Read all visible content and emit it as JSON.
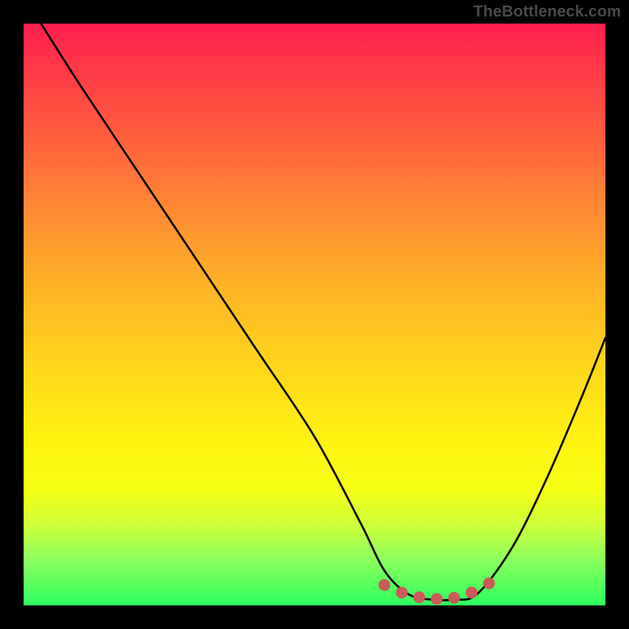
{
  "watermark": "TheBottleneck.com",
  "colors": {
    "background": "#000000",
    "gradient_top": "#ff1f4f",
    "gradient_bottom": "#2cff5e",
    "curve": "#000000",
    "marker_fill": "#cc5a57",
    "marker_stroke": "#cc5a57"
  },
  "chart_data": {
    "type": "line",
    "title": "",
    "xlabel": "",
    "ylabel": "",
    "xlim": [
      0,
      100
    ],
    "ylim": [
      0,
      100
    ],
    "grid": false,
    "series": [
      {
        "name": "bottleneck-curve",
        "x": [
          3,
          10,
          20,
          30,
          40,
          50,
          58,
          62,
          66,
          70,
          74,
          78,
          84,
          90,
          96,
          100
        ],
        "values": [
          100,
          89,
          74,
          59,
          44,
          29,
          14,
          6,
          2,
          1,
          1,
          2,
          10,
          22,
          36,
          46
        ]
      }
    ],
    "annotations": [
      {
        "name": "trough-markers",
        "kind": "scatter",
        "x": [
          62,
          65,
          68,
          71,
          74,
          77,
          80
        ],
        "values": [
          3.5,
          2.2,
          1.4,
          1.1,
          1.3,
          2.2,
          3.8
        ]
      }
    ]
  }
}
